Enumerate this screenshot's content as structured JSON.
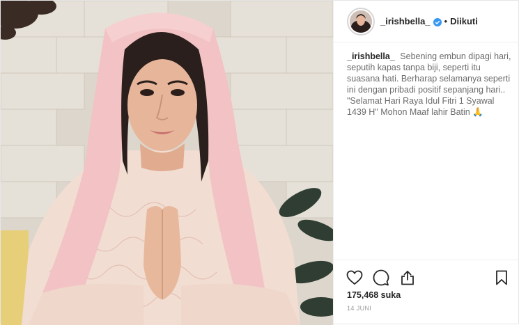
{
  "post": {
    "username": "_irishbella_",
    "separator": "•",
    "follow_label": "Diikuti",
    "caption": {
      "user": "_irishbella_",
      "text": "Sebening embun dipagi hari, seputih kapas tanpa biji, seperti itu suasana hati. Berharap selamanya seperti ini dengan pribadi positif sepanjang hari.. \"Selamat Hari Raya Idul Fitri 1 Syawal 1439 H\" Mohon Maaf lahir Batin 🙏"
    },
    "likes": "175,468 suka",
    "date": "14 JUNI"
  },
  "icons": {
    "verified": "verified-badge-icon",
    "like": "heart-icon",
    "comment": "comment-icon",
    "share": "share-icon",
    "save": "bookmark-icon"
  },
  "colors": {
    "verified_blue": "#3897f0",
    "text": "#262626",
    "muted": "#999999",
    "border": "#efefef"
  }
}
